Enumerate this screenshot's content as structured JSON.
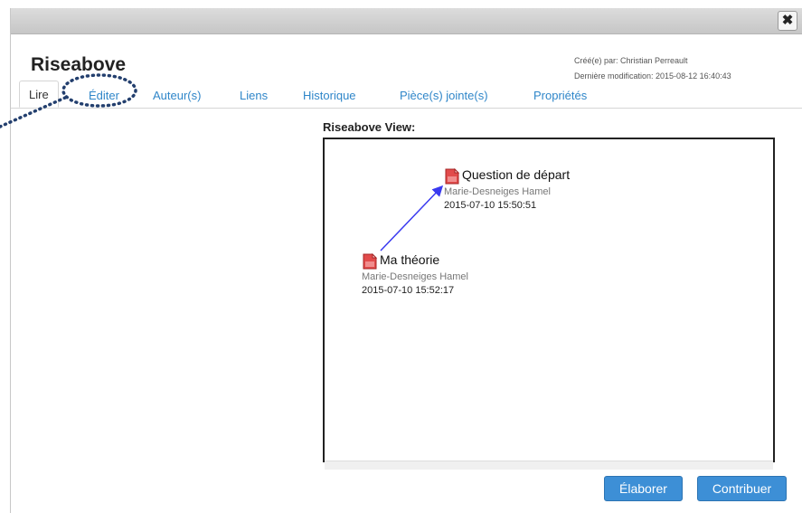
{
  "window": {
    "close_glyph": "✖"
  },
  "note": {
    "title": "Riseabove",
    "created_by": "Créé(e) par: Christian Perreault",
    "last_modified": "Dernière modification: 2015-08-12 16:40:43"
  },
  "tabs": [
    {
      "label": "Lire",
      "active": true
    },
    {
      "label": "Éditer",
      "active": false,
      "highlighted": true
    },
    {
      "label": "Auteur(s)",
      "active": false
    },
    {
      "label": "Liens",
      "active": false
    },
    {
      "label": "Historique",
      "active": false
    },
    {
      "label": "Pièce(s) jointe(s)",
      "active": false
    },
    {
      "label": "Propriétés",
      "active": false
    }
  ],
  "riseabove": {
    "label": "Riseabove View:",
    "notes": [
      {
        "name": "Question de départ",
        "author": "Marie-Desneiges Hamel",
        "date": "2015-07-10 15:50:51",
        "icon": "note-icon"
      },
      {
        "name": "Ma théorie",
        "author": "Marie-Desneiges Hamel",
        "date": "2015-07-10 15:52:17",
        "icon": "note-icon"
      }
    ],
    "link_color": "#3a3af0"
  },
  "buttons": {
    "build_on": "Élaborer",
    "contribute": "Contribuer"
  },
  "colors": {
    "accent": "#3d8fd6",
    "tab_link": "#2f86c9",
    "annotation": "#233f6e"
  }
}
